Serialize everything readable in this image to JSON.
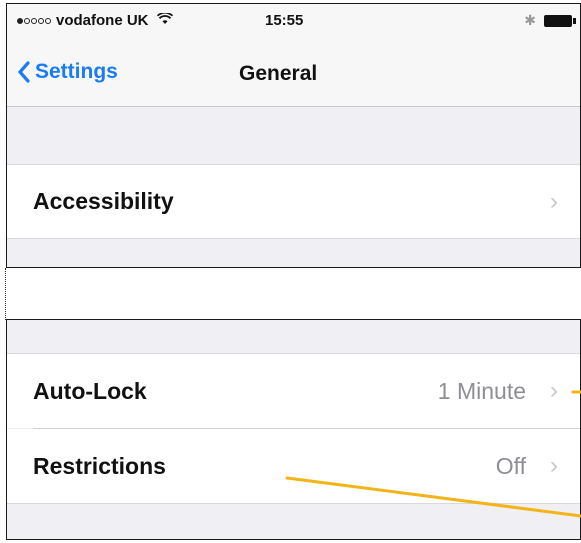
{
  "status_bar": {
    "carrier": "vodafone UK",
    "time": "15:55",
    "wifi_icon": "wifi-icon",
    "bluetooth_icon": "bluetooth-icon",
    "battery_icon": "battery-icon"
  },
  "nav": {
    "back_label": "Settings",
    "title": "General"
  },
  "rows": {
    "accessibility": {
      "label": "Accessibility"
    },
    "auto_lock": {
      "label": "Auto-Lock",
      "value": "1 Minute"
    },
    "restrictions": {
      "label": "Restrictions",
      "value": "Off"
    }
  },
  "colors": {
    "accent": "#1a7cf5",
    "annotation": "#f2b418",
    "background": "#efeff4"
  }
}
